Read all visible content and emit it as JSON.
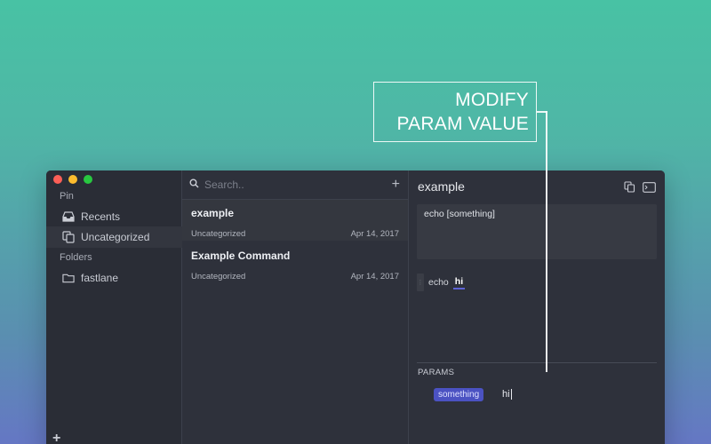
{
  "callout": {
    "line1": "MODIFY",
    "line2": "PARAM VALUE"
  },
  "sidebar": {
    "pin_label": "Pin",
    "folders_label": "Folders",
    "items": [
      {
        "label": "Recents",
        "icon": "inbox-icon"
      },
      {
        "label": "Uncategorized",
        "icon": "copy-icon"
      }
    ],
    "folders": [
      {
        "label": "fastlane",
        "icon": "folder-icon"
      }
    ],
    "add_label": "+"
  },
  "list": {
    "search_placeholder": "Search..",
    "add_label": "+",
    "commands": [
      {
        "title": "example",
        "category": "Uncategorized",
        "date": "Apr 14, 2017"
      },
      {
        "title": "Example Command",
        "category": "Uncategorized",
        "date": "Apr 14, 2017"
      }
    ]
  },
  "detail": {
    "title": "example",
    "code": "echo [something]",
    "preview_command": "echo",
    "preview_value": "hi",
    "params_label": "PARAMS",
    "param_name": "something",
    "param_value": "hi"
  },
  "colors": {
    "accent": "#4b52c2",
    "window_bg": "#2e313b",
    "sidebar_bg": "#2a2d36"
  }
}
